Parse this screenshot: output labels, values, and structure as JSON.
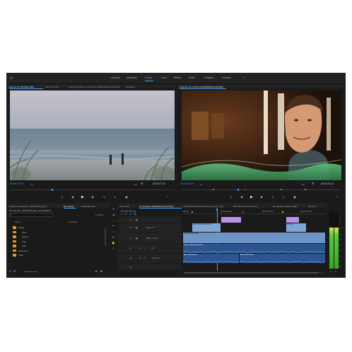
{
  "workspaces": [
    "Learning",
    "Assembly",
    "Editing",
    "Color",
    "Effects",
    "Audio",
    "Graphics",
    "Libraries"
  ],
  "active_workspace": "Editing",
  "more_icon": "»",
  "source_panel": {
    "tabs": [
      "Source: 04 TM Parks Fillb...",
      "Effect Controls",
      "Audio Clip Mixer: 01 COLOR COMPARISON MOVIES",
      "Metadata"
    ],
    "timecode": "00:00:27:22",
    "fit": "Fit",
    "duration": "00:01:47:13",
    "zoom": "Full"
  },
  "program_panel": {
    "tab": "Program: 01 COLOR COMPARISON MOVIES",
    "timecode": "00:00:13:14",
    "fit": "Fit",
    "duration": "00:01:03:13",
    "zoom": "Full"
  },
  "project_panel": {
    "tabs": [
      "Project: PremierePro_WINDOW_Edit_1",
      "Bin: Media",
      "Media Browser"
    ],
    "path": "PremierePro_WINDOW_Edit_1.prproj/Media",
    "item_count": "14 Items",
    "col_name": "Name",
    "col_rate": "Fra Rate",
    "folders": [
      "Finals",
      "VO1",
      "Scene",
      "VO2",
      "VO3",
      "Sound FX",
      "Titles"
    ]
  },
  "timeline_panel": {
    "tabs": [
      "Color Fillin",
      "01 COLOR COMPARISON MOVIES",
      "01 SELECTED COLOR (Vary Curves) Clip",
      "03 Different Selected Clip",
      "05 Variation_8181_LAB01",
      "02 YCC"
    ],
    "timecode": "00:00:13:14",
    "ruler": [
      "00:00",
      "00:00:05:00",
      "00:00:10:00",
      "00:00:15:00"
    ],
    "tracks": [
      {
        "id": "V3",
        "label": ""
      },
      {
        "id": "V2",
        "label": "[Adj] TTT"
      },
      {
        "id": "V1",
        "label": "BBO Layers"
      },
      {
        "id": "A1",
        "label": "A1"
      },
      {
        "id": "A2",
        "label": "Sounds"
      },
      {
        "id": "A3",
        "label": ""
      }
    ],
    "clips": {
      "v2a": "MG_7142_BLUE Kitty",
      "v2b": "04 Pool",
      "v1a": "04 TM Parks Fillb...",
      "a1a": "Audio_0000_Mixdown2",
      "a2a": "Bet Cross Dress",
      "a2b": "Bet Cross Dress"
    }
  },
  "audio_meter": {
    "level": 0.72,
    "scale": [
      "0",
      "-6",
      "-12",
      "-18",
      "-24",
      "-30",
      "-36",
      "-42",
      "-48",
      "-54",
      "dB"
    ]
  },
  "colors": {
    "accent": "#3f9bff",
    "folder": "#e69a21",
    "video_clip": "#7ea7d6",
    "adjustment_clip": "#b892e6",
    "audio_clip": "#2c5590"
  }
}
